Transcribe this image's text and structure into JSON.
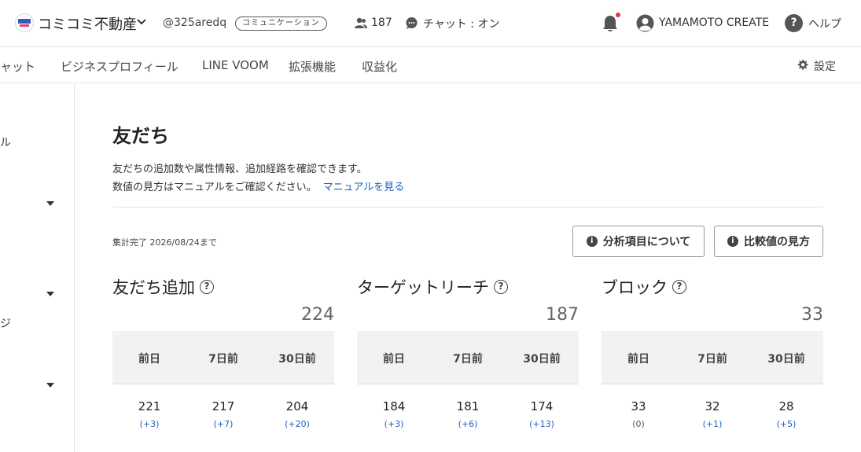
{
  "header": {
    "account_name": "コミコミ不動産",
    "account_id": "@325aredq",
    "plan": "コミュニケーション",
    "friends_count": "187",
    "chat_status": "チャット : オン",
    "user_name": "YAMAMOTO CREATE",
    "help": "ヘルプ"
  },
  "nav": {
    "items": [
      "ャット",
      "ビジネスプロフィール",
      "LINE VOOM",
      "拡張機能",
      "収益化"
    ],
    "settings": "設定"
  },
  "sidebar": {
    "fragments": [
      "ル",
      "ジ"
    ]
  },
  "main": {
    "title": "友だち",
    "desc_line1": "友だちの追加数や属性情報、追加経路を確認できます。",
    "desc_line2": "数値の見方はマニュアルをご確認ください。",
    "manual_link": "マニュアルを見る",
    "aggregation": "集計完了 2026/08/24まで",
    "btn_about": "分析項目について",
    "btn_compare": "比較値の見方"
  },
  "cards": [
    {
      "title": "友だち追加",
      "total": "224",
      "headers": [
        "前日",
        "7日前",
        "30日前"
      ],
      "values": [
        "221",
        "217",
        "204"
      ],
      "diffs": [
        "(+3)",
        "(+7)",
        "(+20)"
      ]
    },
    {
      "title": "ターゲットリーチ",
      "total": "187",
      "headers": [
        "前日",
        "7日前",
        "30日前"
      ],
      "values": [
        "184",
        "181",
        "174"
      ],
      "diffs": [
        "(+3)",
        "(+6)",
        "(+13)"
      ]
    },
    {
      "title": "ブロック",
      "total": "33",
      "headers": [
        "前日",
        "7日前",
        "30日前"
      ],
      "values": [
        "33",
        "32",
        "28"
      ],
      "diffs": [
        "(0)",
        "(+1)",
        "(+5)"
      ]
    }
  ]
}
